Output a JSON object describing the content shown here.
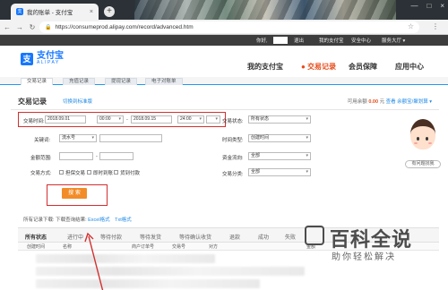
{
  "browser": {
    "tab_title": "我的账单 - 支付宝",
    "tab_close": "×",
    "new_tab": "+",
    "url": "https://consumeprod.alipay.com/record/advanced.htm",
    "window_controls": [
      "—",
      "□",
      "×"
    ]
  },
  "topbar": {
    "greeting": "你好,",
    "logout": "退出",
    "my_alipay": "我的支付宝",
    "security_center": "安全中心",
    "service_hall": "服务大厅 ▾"
  },
  "header": {
    "logo_cn": "支付宝",
    "logo_en": "ALIPAY",
    "nav": [
      "我的支付宝",
      "交易记录",
      "会员保障",
      "应用中心"
    ],
    "active_nav": "交易记录"
  },
  "subtabs": [
    "交易记录",
    "充值记录",
    "提现记录",
    "电子对账单"
  ],
  "panel": {
    "title": "交易记录",
    "title_link": "切换到标准版",
    "balance_label": "可用余额",
    "balance_amount": "0.00",
    "balance_unit": "元",
    "balance_link": "查看",
    "balance_extra": "余额宝/聚划算 ▾"
  },
  "filters": {
    "trade_time_label": "交易时间:",
    "start_date": "2018.09.01",
    "start_time": "00:00",
    "dash": "-",
    "end_date": "2018.09.15",
    "end_time": "24:00",
    "trade_status_label": "交易状态:",
    "trade_status_value": "所有状态",
    "keyword_label": "关键词:",
    "keyword_select": "流水号",
    "time_type_label": "时间类型:",
    "time_type_value": "创建时间",
    "amount_label": "金额范围:",
    "amount_dash": "-",
    "fund_flow_label": "资金流向:",
    "fund_flow_value": "全部",
    "method_label": "交易方式:",
    "method_options": [
      "担保交易",
      "即时到账",
      "货到付款"
    ],
    "category_label": "交易分类:",
    "category_value": "全部",
    "search_button": "搜 索"
  },
  "download": {
    "prefix": "所有记录下载:",
    "text": "下载查询结果:",
    "excel": "Excel格式",
    "txt": "Txt格式"
  },
  "status_tabs": [
    "所有状态",
    "进行中",
    "等待付款",
    "等待发货",
    "等待确认收货",
    "退款",
    "成功",
    "失败"
  ],
  "columns": [
    "创建时间",
    "名称",
    "商户订单号",
    "交易号",
    "对方",
    "金额"
  ],
  "helper": {
    "bubble": "有问题找我"
  },
  "watermark": {
    "title": "百科全说",
    "subtitle": "助你轻松解决"
  }
}
